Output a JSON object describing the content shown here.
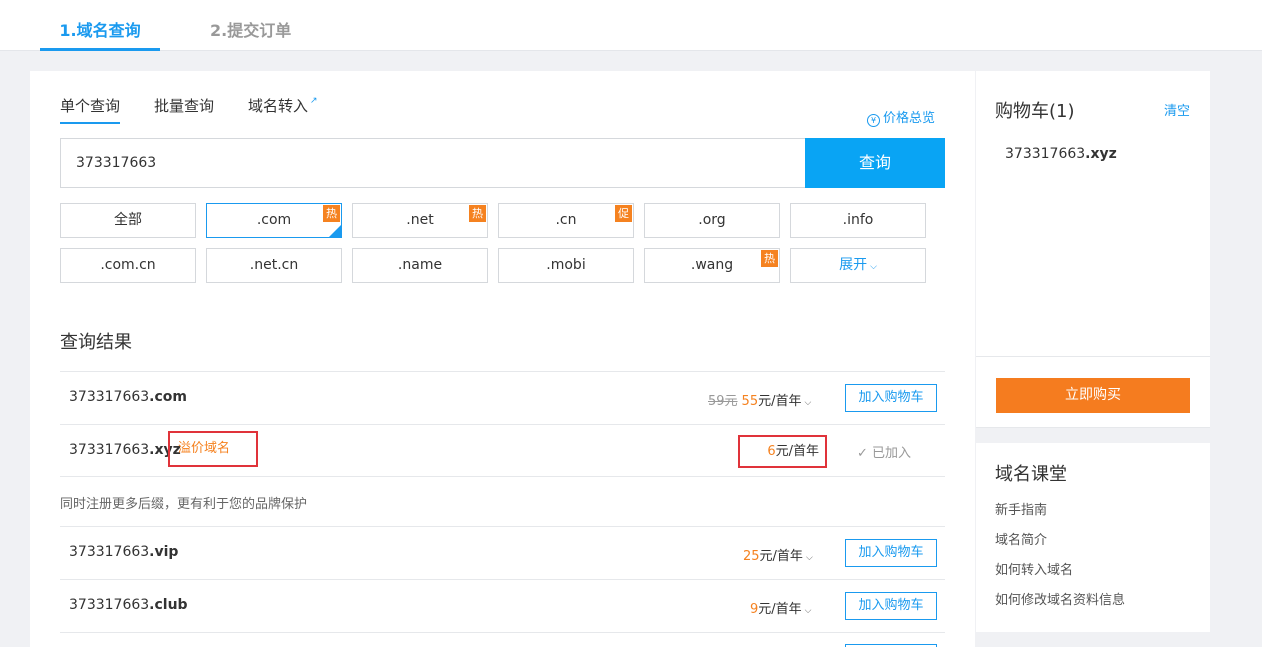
{
  "steps": {
    "step1": "1.域名查询",
    "step2": "2.提交订单"
  },
  "tabs": {
    "single": "单个查询",
    "batch": "批量查询",
    "transfer": "域名转入",
    "external_icon": "external-link-icon"
  },
  "price_overview": {
    "icon": "¥",
    "label": "价格总览"
  },
  "search": {
    "value": "373317663",
    "button": "查询"
  },
  "suffixes": [
    {
      "label": "全部",
      "tag": ""
    },
    {
      "label": ".com",
      "tag": "热",
      "selected": true
    },
    {
      "label": ".net",
      "tag": "热"
    },
    {
      "label": ".cn",
      "tag": "促"
    },
    {
      "label": ".org",
      "tag": ""
    },
    {
      "label": ".info",
      "tag": ""
    },
    {
      "label": ".com.cn",
      "tag": ""
    },
    {
      "label": ".net.cn",
      "tag": ""
    },
    {
      "label": ".name",
      "tag": ""
    },
    {
      "label": ".mobi",
      "tag": ""
    },
    {
      "label": ".wang",
      "tag": "热"
    },
    {
      "label": "展开",
      "tag": ""
    }
  ],
  "results": {
    "title": "查询结果",
    "rows": [
      {
        "prefix": "373317663",
        "suffix": ".com",
        "old_price": "59元",
        "price": "55",
        "unit": "元/首年",
        "action": "加入购物车"
      },
      {
        "prefix": "373317663",
        "suffix": ".xyz",
        "premium": "溢价域名",
        "price": "6",
        "unit": "元/首年",
        "action": "已加入"
      }
    ],
    "hint": "同时注册更多后缀，更有利于您的品牌保护",
    "more_rows": [
      {
        "prefix": "373317663",
        "suffix": ".vip",
        "price": "25",
        "unit": "元/首年",
        "action": "加入购物车"
      },
      {
        "prefix": "373317663",
        "suffix": ".club",
        "price": "9",
        "unit": "元/首年",
        "action": "加入购物车"
      }
    ]
  },
  "cart": {
    "title": "购物车(1)",
    "clear": "清空",
    "item_prefix": "373317663",
    "item_suffix": ".xyz",
    "buy": "立即购买"
  },
  "edu": {
    "title": "域名课堂",
    "links": [
      "新手指南",
      "域名简介",
      "如何转入域名",
      "如何修改域名资料信息"
    ]
  },
  "colors": {
    "accent": "#1a9aef",
    "orange": "#f58220",
    "highlight": "#e0333a"
  }
}
